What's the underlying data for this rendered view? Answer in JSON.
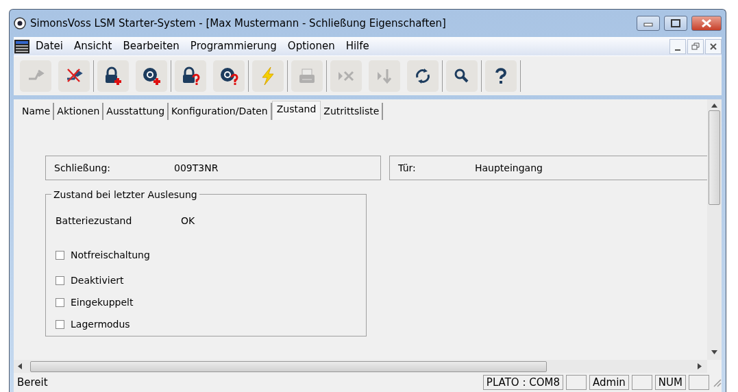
{
  "window": {
    "title": "SimonsVoss LSM Starter-System - [Max Mustermann - Schließung Eigenschaften]"
  },
  "menu": [
    "Datei",
    "Ansicht",
    "Bearbeiten",
    "Programmierung",
    "Optionen",
    "Hilfe"
  ],
  "toolbar_groups": [
    [
      {
        "kind": "transfer",
        "disabled": true
      },
      {
        "kind": "transfer-cancel",
        "disabled": false
      }
    ],
    [
      {
        "kind": "lock-add",
        "disabled": false
      },
      {
        "kind": "knob-add",
        "disabled": false
      }
    ],
    [
      {
        "kind": "lock-query",
        "disabled": false
      },
      {
        "kind": "knob-query",
        "disabled": false
      }
    ],
    [
      {
        "kind": "lightning",
        "disabled": false
      }
    ],
    [
      {
        "kind": "printer",
        "disabled": true
      }
    ],
    [
      {
        "kind": "skip-x",
        "disabled": true
      },
      {
        "kind": "skip-down",
        "disabled": true
      },
      {
        "kind": "sync",
        "disabled": false
      }
    ],
    [
      {
        "kind": "search",
        "disabled": false
      }
    ],
    [
      {
        "kind": "help",
        "disabled": false
      }
    ]
  ],
  "tabs": [
    {
      "label": "Name",
      "selected": false
    },
    {
      "label": "Aktionen",
      "selected": false
    },
    {
      "label": "Ausstattung",
      "selected": false
    },
    {
      "label": "Konfiguration/Daten",
      "selected": false
    },
    {
      "label": "Zustand",
      "selected": true
    },
    {
      "label": "Zutrittsliste",
      "selected": false
    }
  ],
  "info": [
    {
      "label": "Schließung:",
      "value": "009T3NR"
    },
    {
      "label": "Tür:",
      "value": "Haupteingang"
    }
  ],
  "group": {
    "title": "Zustand bei letzter Auslesung",
    "battery_label": "Batteriezustand",
    "battery_value": "OK",
    "checkboxes": [
      {
        "label": "Notfreischaltung",
        "checked": false
      },
      {
        "label": "Deaktiviert",
        "checked": false
      },
      {
        "label": "Eingekuppelt",
        "checked": false
      },
      {
        "label": "Lagermodus",
        "checked": false
      }
    ]
  },
  "status_bar": {
    "text": "Bereit",
    "panels": [
      {
        "kind": "text",
        "text": "PLATO : COM8"
      },
      {
        "kind": "blank"
      },
      {
        "kind": "text",
        "text": "Admin"
      },
      {
        "kind": "blank"
      },
      {
        "kind": "text",
        "text": "NUM"
      },
      {
        "kind": "blank"
      }
    ]
  }
}
